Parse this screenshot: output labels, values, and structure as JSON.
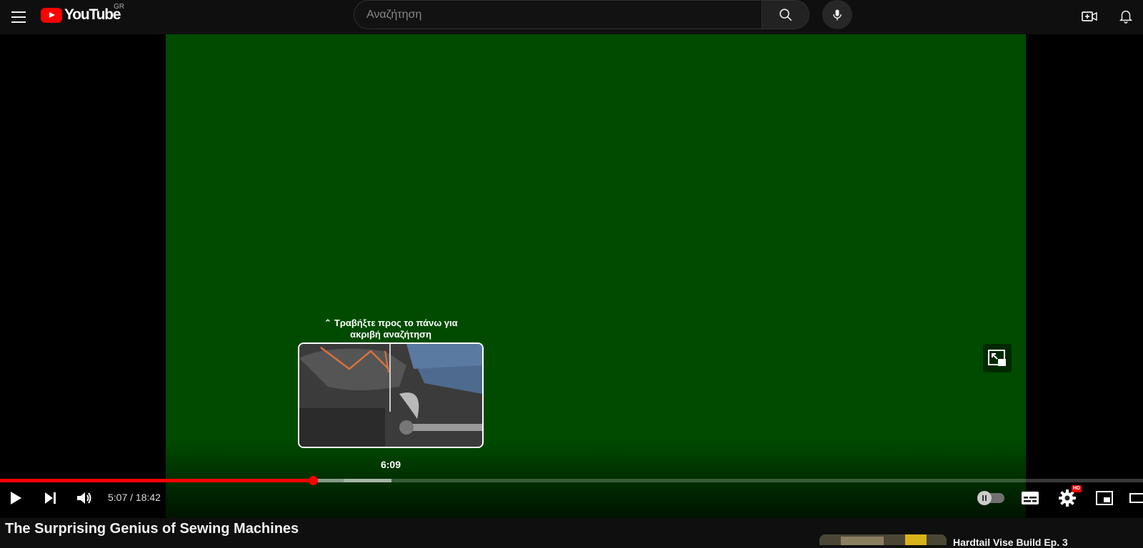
{
  "header": {
    "logo_text": "YouTube",
    "region": "GR",
    "search_placeholder": "Αναζήτηση",
    "icons": [
      "menu-icon",
      "search-icon",
      "mic-icon",
      "create-video-icon",
      "bell-icon"
    ]
  },
  "player": {
    "background_color": "#004b00",
    "seek_hint": "« Τραβήξτε προς το πάνω για ακριβή αναζήτηση",
    "seek_hint_display": "Τραβήξτε προς το πάνω για ακριβή αναζήτηση",
    "preview_time": "6:09",
    "current_time": "5:07",
    "duration": "18:42",
    "time_display": "5:07 / 18:42",
    "played_fraction": 0.2736,
    "loaded_fraction": 0.3005,
    "hover_fraction": 0.3423,
    "accent_color": "#ff0000",
    "hd_badge": "HD"
  },
  "video": {
    "title": "The Surprising Genius of Sewing Machines"
  },
  "recommendations": [
    {
      "title": "Hardtail Vise Build Ep. 3"
    }
  ]
}
